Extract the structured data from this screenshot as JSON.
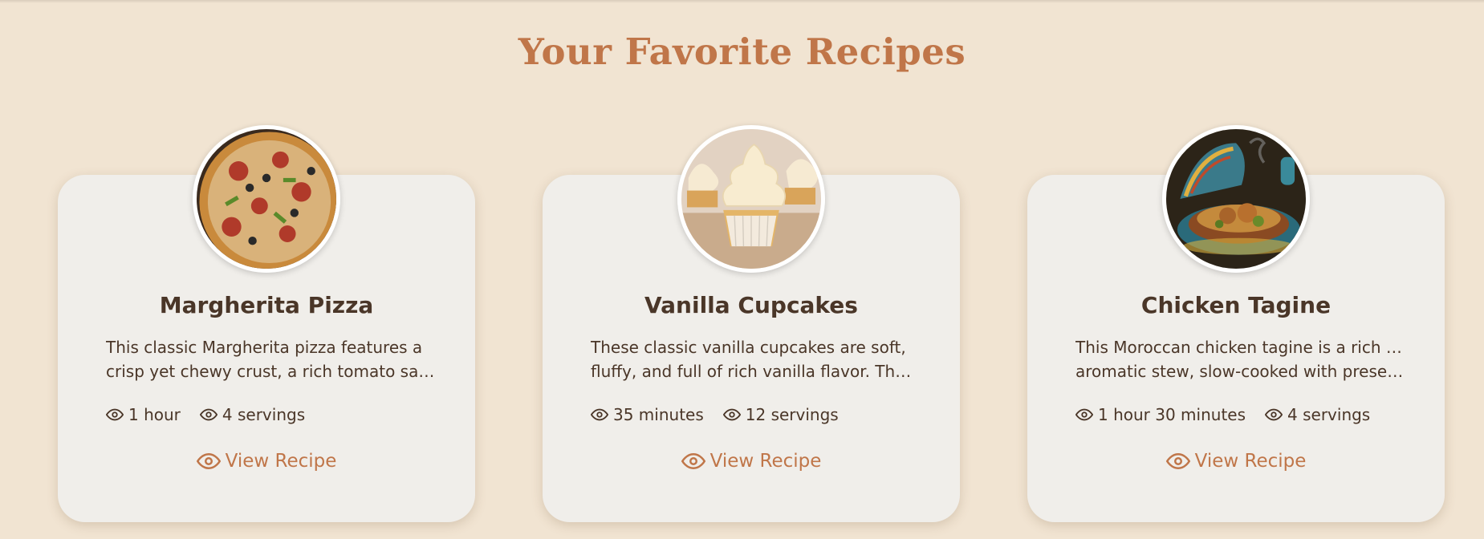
{
  "page": {
    "title": "Your Favorite Recipes"
  },
  "colors": {
    "background": "#f1e4d2",
    "card": "#f0eeea",
    "accent": "#c07649",
    "text": "#4a3628"
  },
  "recipes": [
    {
      "name": "Margherita Pizza",
      "description_line1": "This classic Margherita pizza features a",
      "description_line2": "crisp yet chewy crust, a rich tomato sauce...",
      "time": "1 hour",
      "servings": "4 servings",
      "action_label": "View Recipe",
      "time_icon": "eye-icon",
      "servings_icon": "eye-icon",
      "action_icon": "eye-icon"
    },
    {
      "name": "Vanilla Cupcakes",
      "description_line1": "These classic vanilla cupcakes are soft,",
      "description_line2": "fluffy, and full of rich vanilla flavor. They’r...",
      "time": "35 minutes",
      "servings": "12 servings",
      "action_label": "View Recipe",
      "time_icon": "eye-icon",
      "servings_icon": "eye-icon",
      "action_icon": "eye-icon"
    },
    {
      "name": "Chicken Tagine",
      "description_line1": "This Moroccan chicken tagine is a rich and",
      "description_line2": "aromatic stew, slow-cooked with preserv...",
      "time": "1 hour 30 minutes",
      "servings": "4 servings",
      "action_label": "View Recipe",
      "time_icon": "eye-icon",
      "servings_icon": "eye-icon",
      "action_icon": "eye-icon"
    }
  ]
}
